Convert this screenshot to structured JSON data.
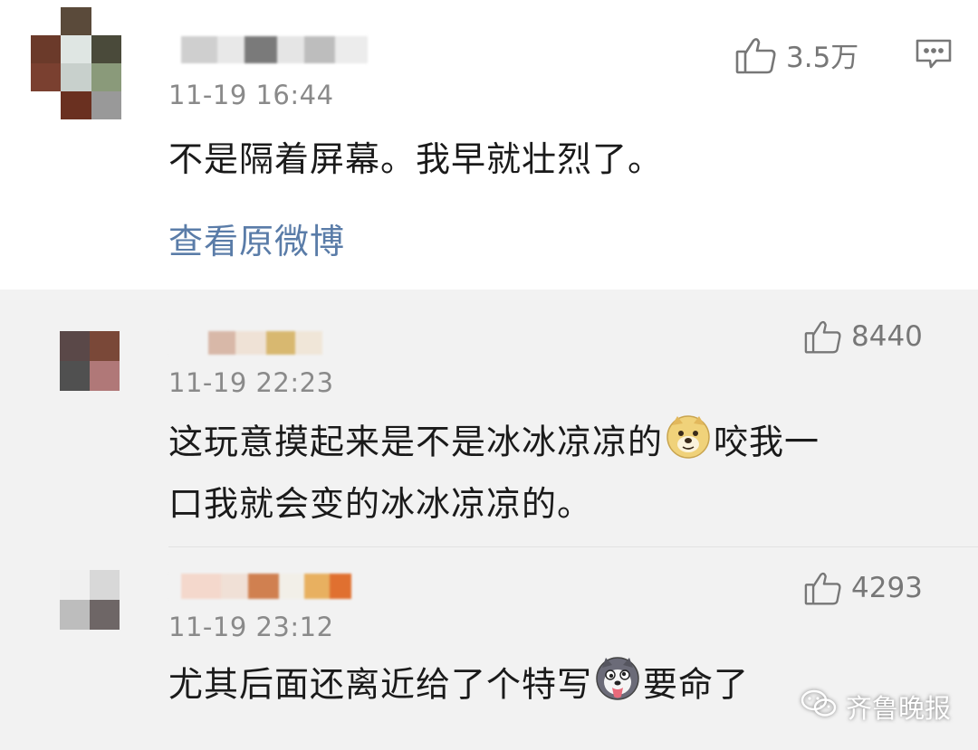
{
  "main_comment": {
    "time": "11-19 16:44",
    "text": "不是隔着屏幕。我早就壮烈了。",
    "view_original": "查看原微博",
    "likes": "3.5万",
    "like_icon": "thumbs-up-icon",
    "comment_icon": "comment-bubble-icon"
  },
  "replies": [
    {
      "time": "11-19 22:23",
      "text_line1_a": "这玩意摸起来是不是冰冰凉凉的",
      "emoji1": "doge-emoji",
      "text_line1_b": "咬我一",
      "text_line2": "口我就会变的冰冰凉凉的。",
      "likes": "8440"
    },
    {
      "time": "11-19 23:12",
      "text_a": "尤其后面还离近给了个特写",
      "emoji1": "husky-emoji",
      "text_b": "要命了",
      "likes": "4293"
    }
  ],
  "watermark": {
    "text": "齐鲁晚报",
    "icon": "wechat-icon"
  },
  "colors": {
    "link": "#5a7ca8",
    "meta": "#8a8a8a",
    "reply_bg": "#f2f2f2"
  }
}
